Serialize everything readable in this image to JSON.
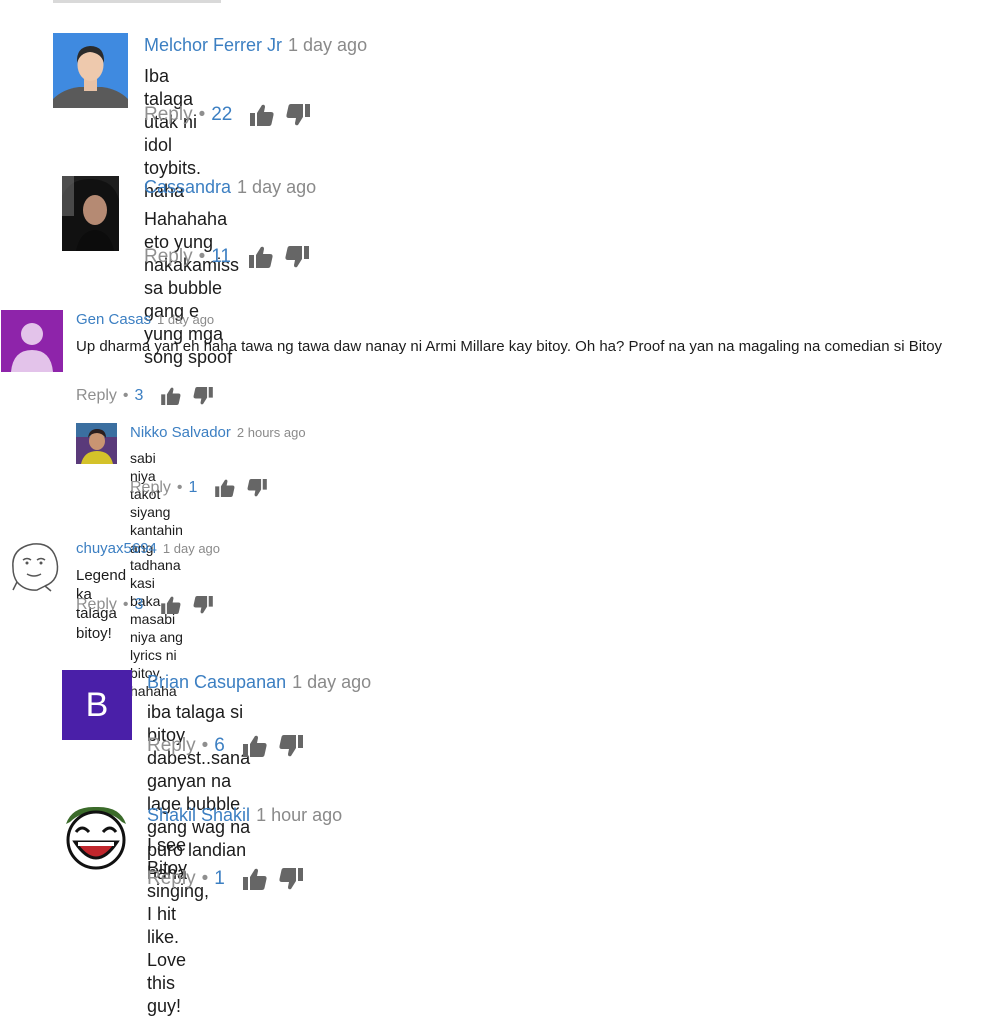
{
  "comments": [
    {
      "author": "Melchor Ferrer Jr",
      "time": "1 day ago",
      "text": "Iba talaga utak ni idol toybits. haha",
      "reply_label": "Reply",
      "likes": "22"
    },
    {
      "author": "Cassandra",
      "time": "1 day ago",
      "text": "Hahahaha eto yung nakakamiss sa bubble gang e yung mga song spoof",
      "reply_label": "Reply",
      "likes": "11"
    },
    {
      "author": "Gen Casas",
      "time": "1 day ago",
      "text": "Up dharma yan eh haha tawa ng tawa daw nanay ni Armi Millare kay bitoy. Oh ha? Proof na yan na magaling na comedian si Bitoy",
      "reply_label": "Reply",
      "likes": "3"
    },
    {
      "author": "Nikko Salvador",
      "time": "2 hours ago",
      "text": "sabi niya takot siyang kantahin ang tadhana kasi baka masabi niya ang lyrics ni bitoy.  hahaha",
      "reply_label": "Reply",
      "likes": "1"
    },
    {
      "author": "chuyax5694",
      "time": "1 day ago",
      "text": "Legend ka talaga bitoy!",
      "reply_label": "Reply",
      "likes": "3"
    },
    {
      "author": "Brian Casupanan",
      "time": "1 day ago",
      "text": "iba talaga si bitoy dabest..sana ganyan na lage bubble gang wag na puro landian haha",
      "reply_label": "Reply",
      "likes": "6",
      "avatar_letter": "B"
    },
    {
      "author": "Shakil Shakil",
      "time": "1 hour ago",
      "text": "I see Bitoy singing, I hit like. Love this guy!",
      "reply_label": "Reply",
      "likes": "1"
    }
  ],
  "separator": "•",
  "icons": {
    "like": "thumb-up-icon",
    "dislike": "thumb-down-icon"
  },
  "colors": {
    "author": "#3c7fc2",
    "meta": "#8a8a8a",
    "brian_avatar": "#4a1fa8",
    "gen_avatar": "#8e24aa"
  }
}
